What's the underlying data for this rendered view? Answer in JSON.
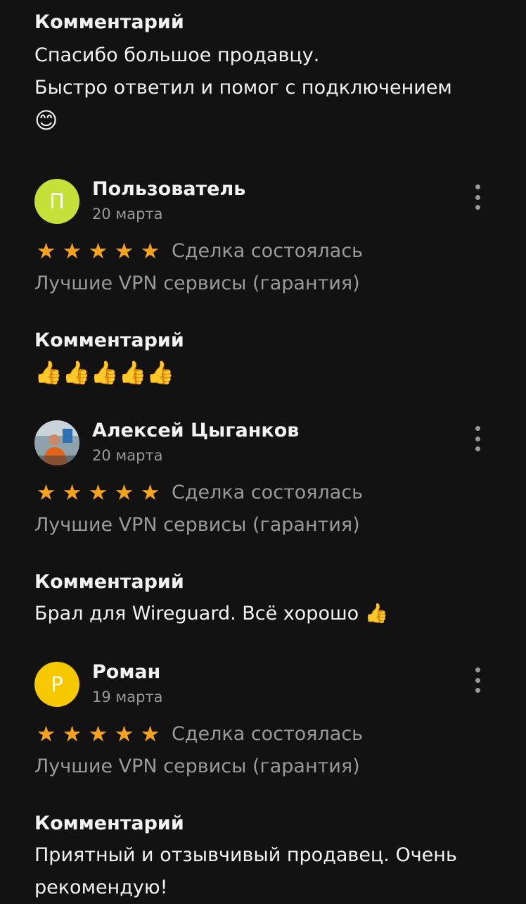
{
  "top": {
    "heading": "Комментарий",
    "line1": "Спасибо большое продавцу.",
    "line2": "Быстро ответил и помог с подключением",
    "emoji": "😊"
  },
  "reviews": [
    {
      "name": "Пользователь",
      "initial": "П",
      "avatar_color": "#c6e03a",
      "date": "20 марта",
      "stars": 5,
      "status": "Сделка состоялась",
      "product": "Лучшие VPN сервисы (гарантия)",
      "comment_heading": "Комментарий",
      "comment": "👍👍👍👍👍"
    },
    {
      "name": "Алексей Цыганков",
      "initial": "",
      "avatar_color": "#5a6b74",
      "date": "20 марта",
      "stars": 5,
      "status": "Сделка состоялась",
      "product": "Лучшие VPN сервисы (гарантия)",
      "comment_heading": "Комментарий",
      "comment": "Брал для Wireguard. Всё хорошо 👍"
    },
    {
      "name": "Роман",
      "initial": "Р",
      "avatar_color": "#f5c800",
      "date": "19 марта",
      "stars": 5,
      "status": "Сделка состоялась",
      "product": "Лучшие VPN сервисы (гарантия)",
      "comment_heading": "Комментарий",
      "comment": "Приятный и отзывчивый продавец. Очень рекомендую!"
    }
  ],
  "colors": {
    "background": "#121212",
    "star": "#f7a21b",
    "muted": "#9a9a9a"
  }
}
